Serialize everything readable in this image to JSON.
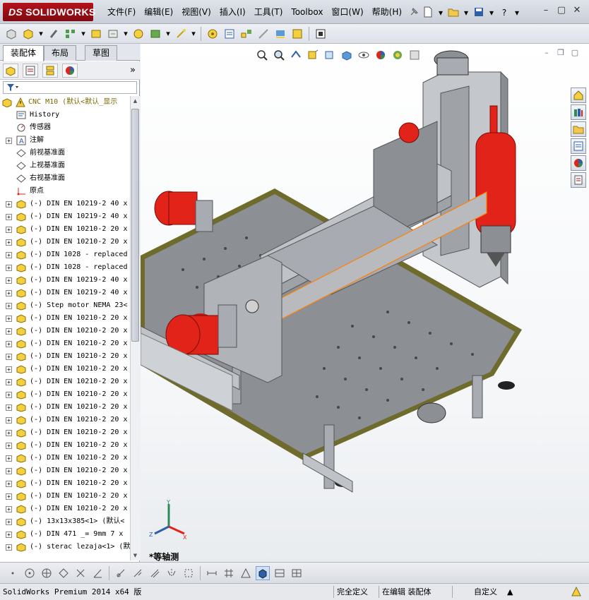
{
  "app": {
    "logo_text": "SOLIDWORKS",
    "logo_prefix": "DS"
  },
  "menu": [
    "文件(F)",
    "编辑(E)",
    "视图(V)",
    "插入(I)",
    "工具(T)",
    "Toolbox",
    "窗口(W)",
    "帮助(H)"
  ],
  "left_panel": {
    "tabs": [
      "装配体",
      "布局",
      "草图"
    ],
    "active_tab": "装配体",
    "more_label": "»",
    "root": "CNC M10  (默认<默认_显示",
    "items": [
      {
        "label": "History",
        "icon": "history-icon",
        "expandable": false
      },
      {
        "label": "传感器",
        "icon": "sensor-icon",
        "expandable": false
      },
      {
        "label": "注解",
        "icon": "annotation-icon",
        "expandable": true
      },
      {
        "label": "前视基准面",
        "icon": "plane-icon",
        "expandable": false
      },
      {
        "label": "上视基准面",
        "icon": "plane-icon",
        "expandable": false
      },
      {
        "label": "右视基准面",
        "icon": "plane-icon",
        "expandable": false
      },
      {
        "label": "原点",
        "icon": "origin-icon",
        "expandable": false
      },
      {
        "label": "(-) DIN EN 10219-2 40 x",
        "icon": "part-icon",
        "expandable": true
      },
      {
        "label": "(-) DIN EN 10219-2 40 x",
        "icon": "part-icon",
        "expandable": true
      },
      {
        "label": "(-) DIN EN 10210-2 20 x",
        "icon": "part-icon",
        "expandable": true
      },
      {
        "label": "(-) DIN EN 10210-2 20 x",
        "icon": "part-icon",
        "expandable": true
      },
      {
        "label": "(-) DIN 1028 - replaced",
        "icon": "part-icon",
        "expandable": true
      },
      {
        "label": "(-) DIN 1028 - replaced",
        "icon": "part-icon",
        "expandable": true
      },
      {
        "label": "(-) DIN EN 10219-2 40 x",
        "icon": "part-icon",
        "expandable": true
      },
      {
        "label": "(-) DIN EN 10219-2 40 x",
        "icon": "part-icon",
        "expandable": true
      },
      {
        "label": "(-) Step motor NEMA 23<",
        "icon": "part-icon",
        "expandable": true
      },
      {
        "label": "(-) DIN EN 10210-2 20 x",
        "icon": "part-icon",
        "expandable": true
      },
      {
        "label": "(-) DIN EN 10210-2 20 x",
        "icon": "part-icon",
        "expandable": true
      },
      {
        "label": "(-) DIN EN 10210-2 20 x",
        "icon": "part-icon",
        "expandable": true
      },
      {
        "label": "(-) DIN EN 10210-2 20 x",
        "icon": "part-icon",
        "expandable": true
      },
      {
        "label": "(-) DIN EN 10210-2 20 x",
        "icon": "part-icon",
        "expandable": true
      },
      {
        "label": "(-) DIN EN 10210-2 20 x",
        "icon": "part-icon",
        "expandable": true
      },
      {
        "label": "(-) DIN EN 10210-2 20 x",
        "icon": "part-icon",
        "expandable": true
      },
      {
        "label": "(-) DIN EN 10210-2 20 x",
        "icon": "part-icon",
        "expandable": true
      },
      {
        "label": "(-) DIN EN 10210-2 20 x",
        "icon": "part-icon",
        "expandable": true
      },
      {
        "label": "(-) DIN EN 10210-2 20 x",
        "icon": "part-icon",
        "expandable": true
      },
      {
        "label": "(-) DIN EN 10210-2 20 x",
        "icon": "part-icon",
        "expandable": true
      },
      {
        "label": "(-) DIN EN 10210-2 20 x",
        "icon": "part-icon",
        "expandable": true
      },
      {
        "label": "(-) DIN EN 10210-2 20 x",
        "icon": "part-icon",
        "expandable": true
      },
      {
        "label": "(-) DIN EN 10210-2 20 x",
        "icon": "part-icon",
        "expandable": true
      },
      {
        "label": "(-) DIN EN 10210-2 20 x",
        "icon": "part-icon",
        "expandable": true
      },
      {
        "label": "(-) DIN EN 10210-2 20 x",
        "icon": "part-icon",
        "expandable": true
      },
      {
        "label": "(-) 13x13x385<1> (默认<",
        "icon": "part-icon",
        "expandable": true
      },
      {
        "label": "(-) DIN 471  _= 9mm 7 x",
        "icon": "part-icon",
        "expandable": true
      },
      {
        "label": "(-) sterac lezaja<1> (默",
        "icon": "part-icon",
        "expandable": true
      }
    ]
  },
  "viewport": {
    "view_label": "*等轴测",
    "triad": {
      "x": "X",
      "y": "Y",
      "z": "Z"
    }
  },
  "status": {
    "product": "SolidWorks Premium 2014 x64 版",
    "constraint": "完全定义",
    "mode": "在编辑 装配体",
    "units": "自定义",
    "units_arrow": "▲"
  },
  "colors": {
    "accent_red": "#e2231a",
    "plate_grey": "#8c8f94",
    "frame_olive": "#6f6b2c",
    "selection_orange": "#ff7f00"
  }
}
